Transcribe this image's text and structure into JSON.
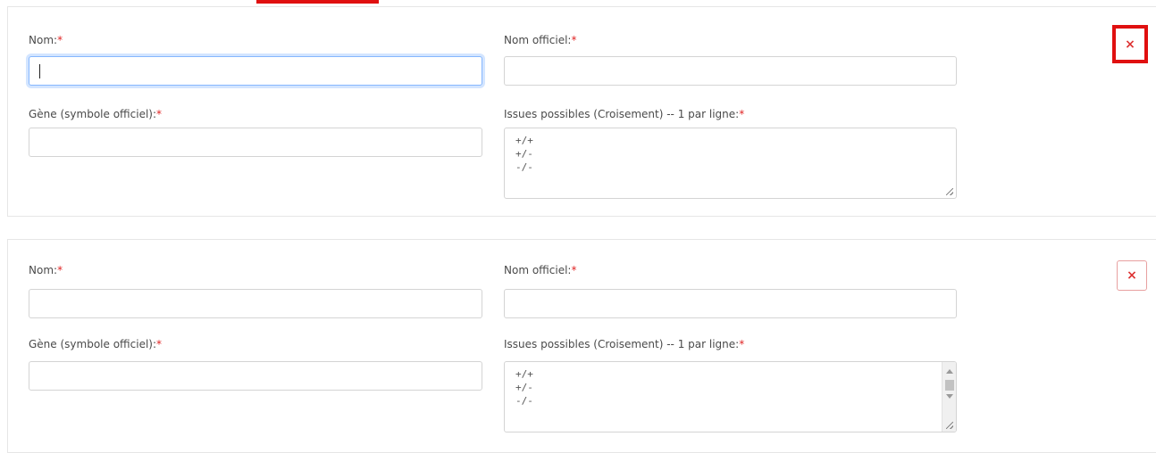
{
  "colors": {
    "required": "#e02424",
    "highlight": "#e01010",
    "focus": "#86b7fe"
  },
  "cards": [
    {
      "nom_label": "Nom:",
      "nom_officiel_label": "Nom officiel:",
      "gene_label": "Gène (symbole officiel):",
      "issues_label": "Issues possibles (Croisement) -- 1 par ligne:",
      "required_mark": "*",
      "nom_value": "",
      "nom_officiel_value": "",
      "gene_value": "",
      "issues_lines": [
        "+/+",
        "+/-",
        "-/-"
      ],
      "delete_icon": "×"
    },
    {
      "nom_label": "Nom:",
      "nom_officiel_label": "Nom officiel:",
      "gene_label": "Gène (symbole officiel):",
      "issues_label": "Issues possibles (Croisement) -- 1 par ligne:",
      "required_mark": "*",
      "nom_value": "",
      "nom_officiel_value": "",
      "gene_value": "",
      "issues_lines": [
        "+/+",
        "+/-",
        "-/-"
      ],
      "delete_icon": "×"
    }
  ]
}
